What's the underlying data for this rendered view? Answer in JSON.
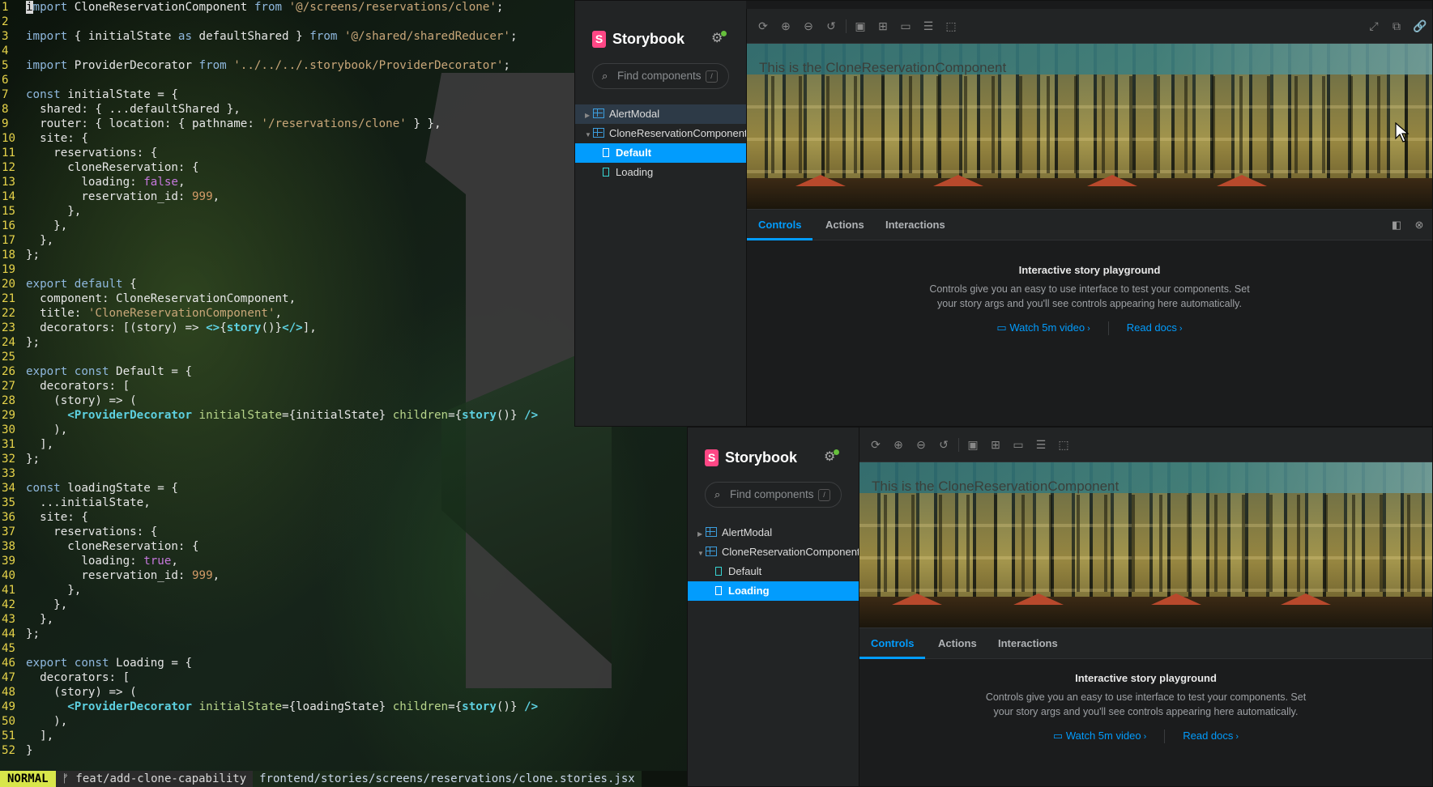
{
  "editor": {
    "lines": [
      {
        "n": "1",
        "html": "<span class='cursor'>i</span><span class='kw'>mport</span> CloneReservationComponent <span class='kw'>from</span> <span class='str'>'@/screens/reservations/clone'</span>;"
      },
      {
        "n": "2",
        "html": ""
      },
      {
        "n": "3",
        "html": "<span class='kw'>import</span> { initialState <span class='kw'>as</span> defaultShared } <span class='kw'>from</span> <span class='str'>'@/shared/sharedReducer'</span>;"
      },
      {
        "n": "4",
        "html": ""
      },
      {
        "n": "5",
        "html": "<span class='kw'>import</span> ProviderDecorator <span class='kw'>from</span> <span class='str'>'../../../.storybook/ProviderDecorator'</span>;"
      },
      {
        "n": "6",
        "html": ""
      },
      {
        "n": "7",
        "html": "<span class='kw'>const</span> initialState = {"
      },
      {
        "n": "8",
        "html": "  shared: { ...defaultShared },"
      },
      {
        "n": "9",
        "html": "  router: { location: { pathname: <span class='str'>'/reservations/clone'</span> } },"
      },
      {
        "n": "10",
        "html": "  site: {"
      },
      {
        "n": "11",
        "html": "    reservations: {"
      },
      {
        "n": "12",
        "html": "      cloneReservation: {"
      },
      {
        "n": "13",
        "html": "        loading: <span class='bool'>false</span>,"
      },
      {
        "n": "14",
        "html": "        reservation_id: <span class='num'>999</span>,"
      },
      {
        "n": "15",
        "html": "      },"
      },
      {
        "n": "16",
        "html": "    },"
      },
      {
        "n": "17",
        "html": "  },"
      },
      {
        "n": "18",
        "html": "};"
      },
      {
        "n": "19",
        "html": ""
      },
      {
        "n": "20",
        "html": "<span class='kw'>export default</span> {"
      },
      {
        "n": "21",
        "html": "  component: CloneReservationComponent,"
      },
      {
        "n": "22",
        "html": "  title: <span class='str'>'CloneReservationComponent'</span>,"
      },
      {
        "n": "23",
        "html": "  decorators: [(story) =&gt; <span class='tag'>&lt;&gt;</span>{<span class='fn'>story</span>()}<span class='tag'>&lt;/&gt;</span>],"
      },
      {
        "n": "24",
        "html": "};"
      },
      {
        "n": "25",
        "html": ""
      },
      {
        "n": "26",
        "html": "<span class='kw'>export const</span> Default = {"
      },
      {
        "n": "27",
        "html": "  decorators: ["
      },
      {
        "n": "28",
        "html": "    (story) =&gt; ("
      },
      {
        "n": "29",
        "html": "      <span class='tag'>&lt;ProviderDecorator</span> <span class='attr'>initialState</span>={initialState} <span class='attr'>children</span>={<span class='fn'>story</span>()} <span class='tag'>/&gt;</span>"
      },
      {
        "n": "30",
        "html": "    ),"
      },
      {
        "n": "31",
        "html": "  ],"
      },
      {
        "n": "32",
        "html": "};"
      },
      {
        "n": "33",
        "html": ""
      },
      {
        "n": "34",
        "html": "<span class='kw'>const</span> loadingState = {"
      },
      {
        "n": "35",
        "html": "  ...initialState,"
      },
      {
        "n": "36",
        "html": "  site: {"
      },
      {
        "n": "37",
        "html": "    reservations: {"
      },
      {
        "n": "38",
        "html": "      cloneReservation: {"
      },
      {
        "n": "39",
        "html": "        loading: <span class='bool'>true</span>,"
      },
      {
        "n": "40",
        "html": "        reservation_id: <span class='num'>999</span>,"
      },
      {
        "n": "41",
        "html": "      },"
      },
      {
        "n": "42",
        "html": "    },"
      },
      {
        "n": "43",
        "html": "  },"
      },
      {
        "n": "44",
        "html": "};"
      },
      {
        "n": "45",
        "html": ""
      },
      {
        "n": "46",
        "html": "<span class='kw'>export const</span> Loading = {"
      },
      {
        "n": "47",
        "html": "  decorators: ["
      },
      {
        "n": "48",
        "html": "    (story) =&gt; ("
      },
      {
        "n": "49",
        "html": "      <span class='tag'>&lt;ProviderDecorator</span> <span class='attr'>initialState</span>={loadingState} <span class='attr'>children</span>={<span class='fn'>story</span>()} <span class='tag'>/&gt;</span>"
      },
      {
        "n": "50",
        "html": "    ),"
      },
      {
        "n": "51",
        "html": "  ],"
      },
      {
        "n": "52",
        "html": "}"
      }
    ],
    "status": {
      "mode": "NORMAL",
      "branch": "ᚠ feat/add-clone-capability",
      "file": "frontend/stories/screens/reservations/clone.stories.jsx"
    }
  },
  "storybook_top": {
    "brand": "Storybook",
    "search_placeholder": "Find components",
    "search_shortcut": "/",
    "tree": [
      {
        "label": "AlertModal",
        "type": "component",
        "state": "hover"
      },
      {
        "label": "CloneReservationComponent",
        "type": "component",
        "state": "expanded"
      },
      {
        "label": "Default",
        "type": "story",
        "state": "selected"
      },
      {
        "label": "Loading",
        "type": "story",
        "state": ""
      }
    ],
    "canvas_text": "This is the CloneReservationComponent",
    "tabs": [
      "Controls",
      "Actions",
      "Interactions"
    ],
    "active_tab": "Controls",
    "empty_title": "Interactive story playground",
    "empty_desc_1": "Controls give you an easy to use interface to test your components. Set",
    "empty_desc_2": "your story args and you'll see controls appearing here automatically.",
    "link_video": "Watch 5m video",
    "link_docs": "Read docs"
  },
  "storybook_bottom": {
    "brand": "Storybook",
    "search_placeholder": "Find components",
    "search_shortcut": "/",
    "tree": [
      {
        "label": "AlertModal",
        "type": "component",
        "state": ""
      },
      {
        "label": "CloneReservationComponent",
        "type": "component",
        "state": "expanded"
      },
      {
        "label": "Default",
        "type": "story",
        "state": ""
      },
      {
        "label": "Loading",
        "type": "story",
        "state": "selected"
      }
    ],
    "canvas_text": "This is the CloneReservationComponent",
    "tabs": [
      "Controls",
      "Actions",
      "Interactions"
    ],
    "active_tab": "Controls",
    "empty_title": "Interactive story playground",
    "empty_desc_1": "Controls give you an easy to use interface to test your components. Set",
    "empty_desc_2": "your story args and you'll see controls appearing here automatically.",
    "link_video": "Watch 5m video",
    "link_docs": "Read docs"
  },
  "colors": {
    "accent": "#029cfd",
    "storybook_brand": "#ff4785",
    "line_numbers": "#e6d34a"
  }
}
